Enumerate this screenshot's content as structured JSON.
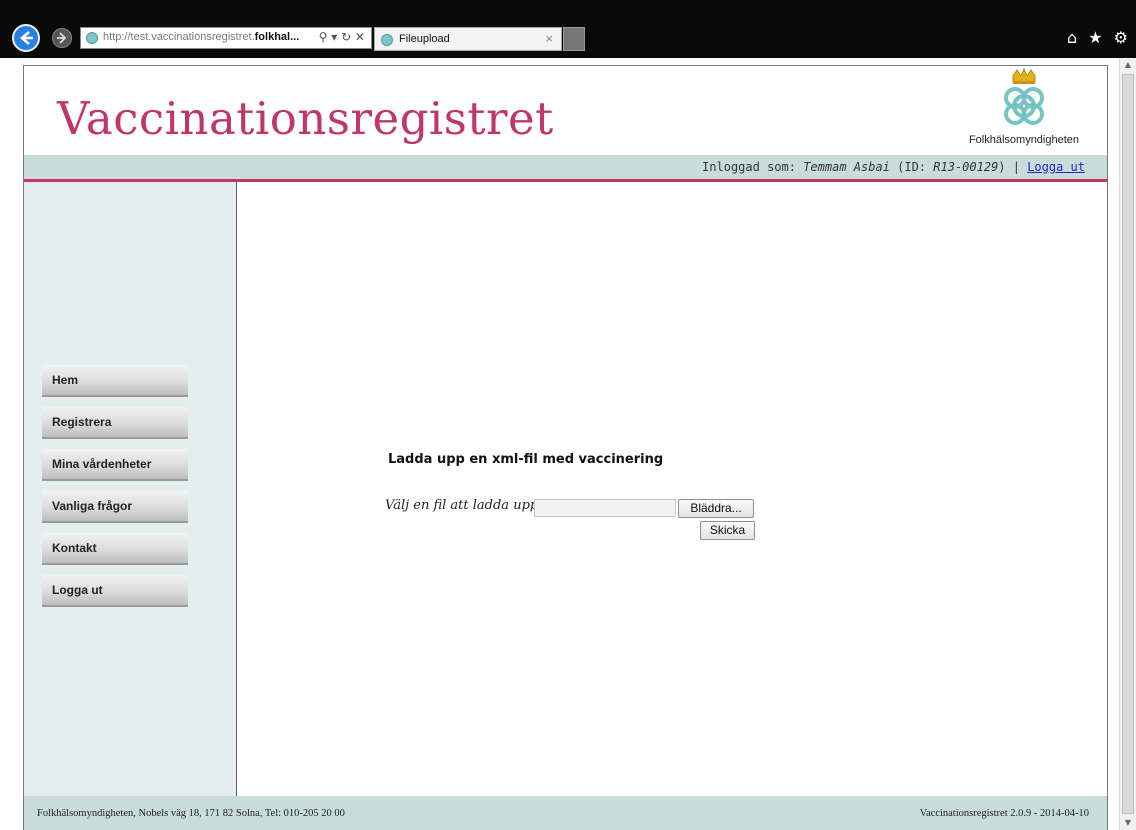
{
  "browser": {
    "url_prefix": "http://test.vaccinationsregistret.",
    "url_domain": "folkhal...",
    "address_tools": "⚲ ▾ ↻ ✕",
    "tab_label": "Fileupload",
    "tab_close": "×",
    "right_icons": {
      "home": "⌂",
      "favorites": "★",
      "settings": "⚙"
    }
  },
  "header": {
    "site_title": "Vaccinationsregistret",
    "logo_text": "Folkhälsomyndigheten"
  },
  "userbar": {
    "prefix": "Inloggad som: ",
    "user_name": "Temmam Asbai",
    "id_open": " (ID: ",
    "user_id": "R13-00129",
    "id_close": ") | ",
    "logout_link": "Logga ut"
  },
  "sidebar": {
    "items": [
      {
        "label": "Hem"
      },
      {
        "label": "Registrera"
      },
      {
        "label": "Mina vårdenheter"
      },
      {
        "label": "Vanliga frågor"
      },
      {
        "label": "Kontakt"
      },
      {
        "label": "Logga ut"
      }
    ]
  },
  "main": {
    "title": "Ladda upp en xml-fil med vaccinering",
    "file_label": "Välj en fil att ladda upp:",
    "file_value": "",
    "browse_button": "Bläddra...",
    "submit_button": "Skicka"
  },
  "footer": {
    "left": "Folkhälsomyndigheten, Nobels väg 18, 171 82 Solna, Tel: 010-205 20 00",
    "right": "Vaccinationsregistret 2.0.9 - 2014-04-10"
  },
  "colors": {
    "brand_pink": "#c0356a",
    "band_teal": "#c8ddda",
    "sidebar_bg": "#e5eeee"
  }
}
